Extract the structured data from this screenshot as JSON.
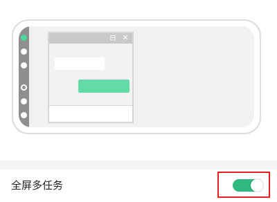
{
  "illustration": {
    "dock_icons": [
      "app-icon-active",
      "circle-icon",
      "circle-icon",
      "ring-icon",
      "circle-icon",
      "circle-icon"
    ],
    "window_buttons": {
      "minimize_icon": "minimize-icon",
      "minimize_symbol": "⊟",
      "close_icon": "close-icon",
      "close_symbol": "✕"
    }
  },
  "settings": {
    "multitask": {
      "label": "全屏多任务",
      "enabled": true,
      "accent_color": "#2fb87f",
      "highlight_color": "#e51d1d"
    }
  }
}
